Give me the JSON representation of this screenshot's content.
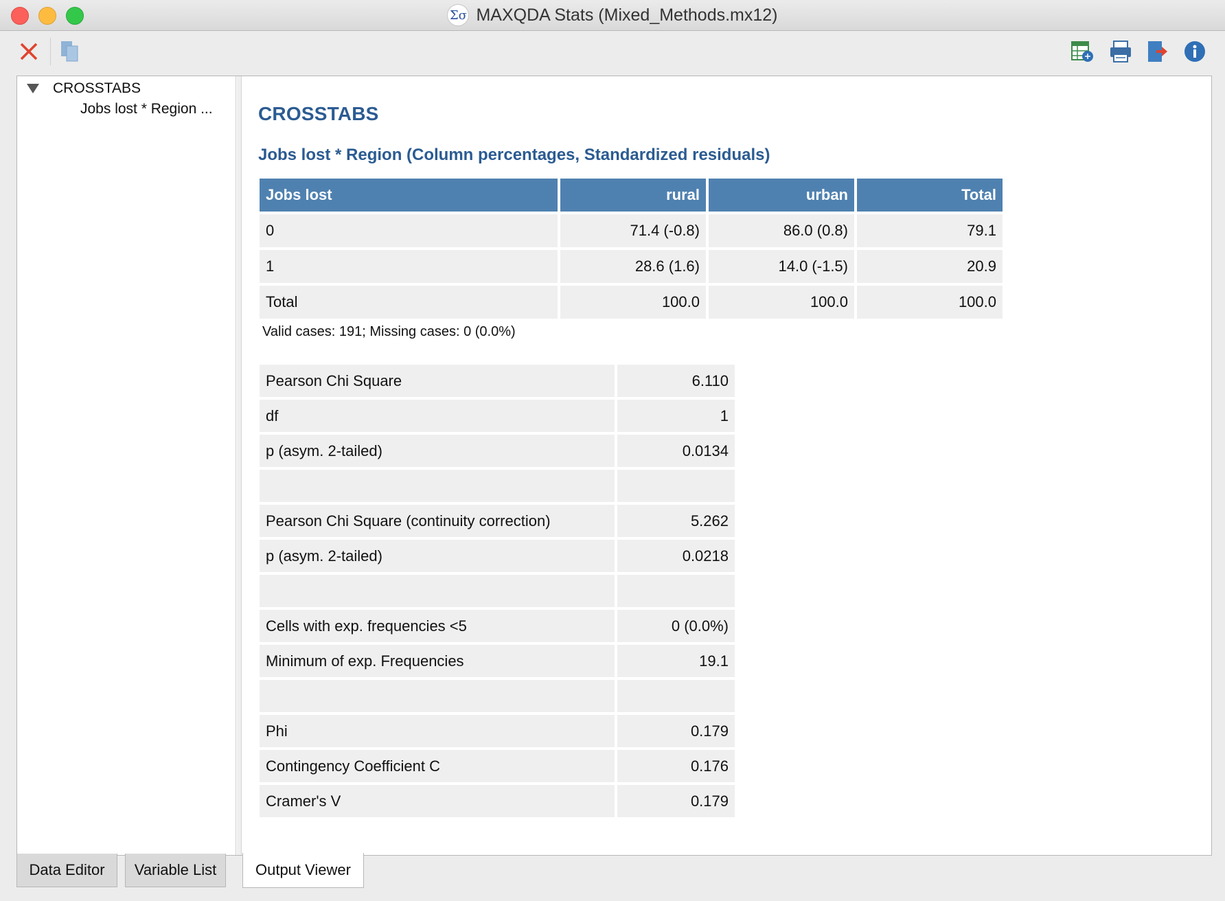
{
  "window": {
    "title": "MAXQDA Stats (Mixed_Methods.mx12)",
    "app_icon_glyph": "Σσ"
  },
  "toolbar": {
    "close_icon": "close-icon",
    "copy_icon": "copy-icon",
    "right_icons": [
      "excel-export-icon",
      "print-icon",
      "export-icon",
      "info-icon"
    ]
  },
  "tree": {
    "root_label": "CROSSTABS",
    "child_label": "Jobs lost * Region ..."
  },
  "output": {
    "heading": "CROSSTABS",
    "subheading": "Jobs lost * Region (Column percentages, Standardized residuals)",
    "crosstab": {
      "headers": [
        "Jobs lost",
        "rural",
        "urban",
        "Total"
      ],
      "rows": [
        [
          "0",
          "71.4 (-0.8)",
          "86.0 (0.8)",
          "79.1"
        ],
        [
          "1",
          "28.6 (1.6)",
          "14.0 (-1.5)",
          "20.9"
        ],
        [
          "Total",
          "100.0",
          "100.0",
          "100.0"
        ]
      ]
    },
    "note": "Valid cases: 191; Missing cases: 0 (0.0%)",
    "stats": [
      [
        "Pearson Chi Square",
        "6.110"
      ],
      [
        "df",
        "1"
      ],
      [
        "p (asym. 2-tailed)",
        "0.0134"
      ],
      [
        "",
        ""
      ],
      [
        "Pearson Chi Square (continuity correction)",
        "5.262"
      ],
      [
        "p (asym. 2-tailed)",
        "0.0218"
      ],
      [
        "",
        ""
      ],
      [
        "Cells with exp. frequencies <5",
        "0 (0.0%)"
      ],
      [
        "Minimum of exp. Frequencies",
        "19.1"
      ],
      [
        "",
        ""
      ],
      [
        "Phi",
        "0.179"
      ],
      [
        "Contingency Coefficient C",
        "0.176"
      ],
      [
        "Cramer's V",
        "0.179"
      ]
    ]
  },
  "tabs": [
    "Data Editor",
    "Variable List",
    "Output Viewer"
  ],
  "colors": {
    "header_blue": "#4f81b0",
    "title_blue": "#2b5b92",
    "cell_gray": "#efefef"
  }
}
